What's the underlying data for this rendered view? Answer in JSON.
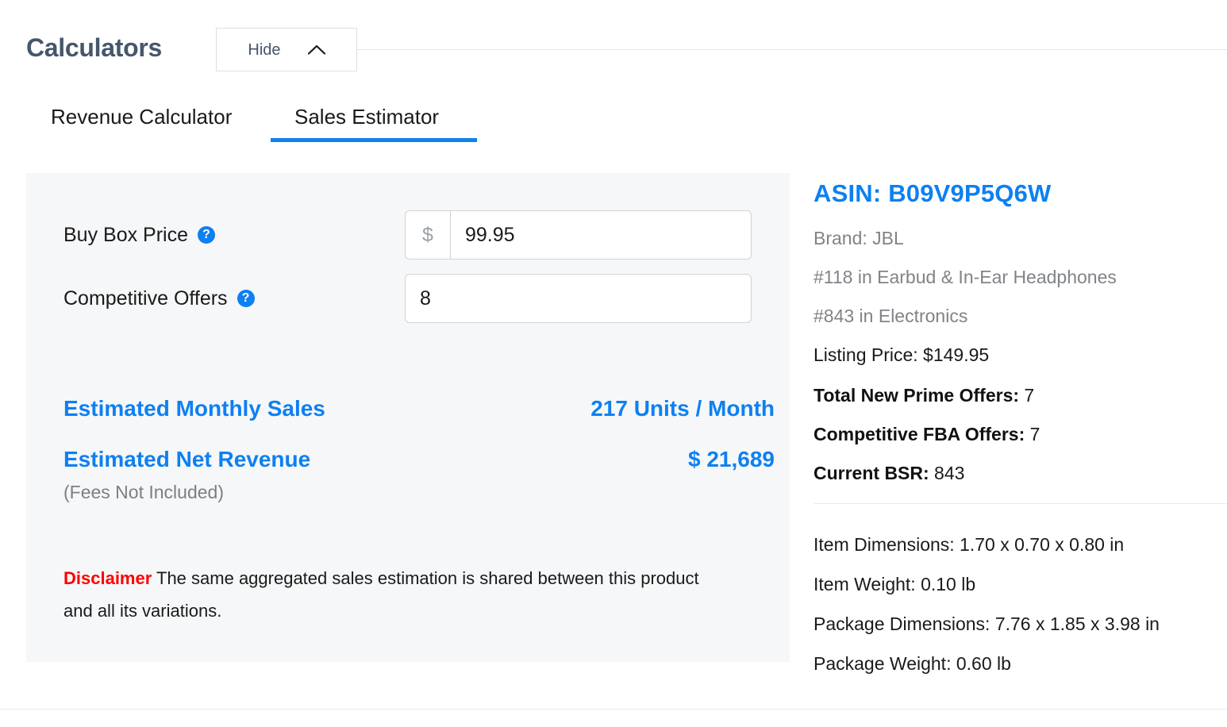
{
  "header": {
    "title": "Calculators",
    "hide_button_label": "Hide",
    "chevron_icon": "chevron-up-icon"
  },
  "tabs": [
    {
      "label": "Revenue Calculator",
      "active": false
    },
    {
      "label": "Sales Estimator",
      "active": true
    }
  ],
  "calculator": {
    "fields": [
      {
        "label": "Buy Box Price",
        "help_icon": "help-circle-icon",
        "prefix": "$",
        "value": "99.95",
        "placeholder": ""
      },
      {
        "label": "Competitive Offers",
        "help_icon": "help-circle-icon",
        "prefix": "",
        "value": "8",
        "placeholder": ""
      }
    ],
    "results": [
      {
        "label": "Estimated Monthly Sales",
        "value": "217 Units / Month"
      },
      {
        "label": "Estimated Net Revenue",
        "value": "$ 21,689"
      }
    ],
    "results_note": "(Fees Not Included)",
    "disclaimer_label": "Disclaimer",
    "disclaimer_text": " The same aggregated sales estimation is shared between this product and all its variations."
  },
  "product_info": {
    "asin_title": "ASIN: B09V9P5Q6W",
    "brand": "Brand: JBL",
    "rank_category": "#118 in Earbud & In-Ear Headphones",
    "rank_department": "#843 in Electronics",
    "listing_price": "Listing Price: $149.95",
    "prime_offers_label": "Total New Prime Offers:",
    "prime_offers_value": " 7",
    "fba_offers_label": "Competitive FBA Offers:",
    "fba_offers_value": " 7",
    "bsr_label": "Current BSR:",
    "bsr_value": " 843",
    "item_dimensions": "Item Dimensions: 1.70 x 0.70 x 0.80 in",
    "item_weight": "Item Weight: 0.10 lb",
    "package_dimensions": "Package Dimensions: 7.76 x 1.85 x 3.98 in",
    "package_weight": "Package Weight: 0.60 lb"
  },
  "colors": {
    "accent_blue": "#0d80f2",
    "title_slate": "#46566b",
    "panel_gray": "#f6f7f8",
    "disclaimer_red": "#ff0000",
    "muted_gray": "#808387"
  }
}
